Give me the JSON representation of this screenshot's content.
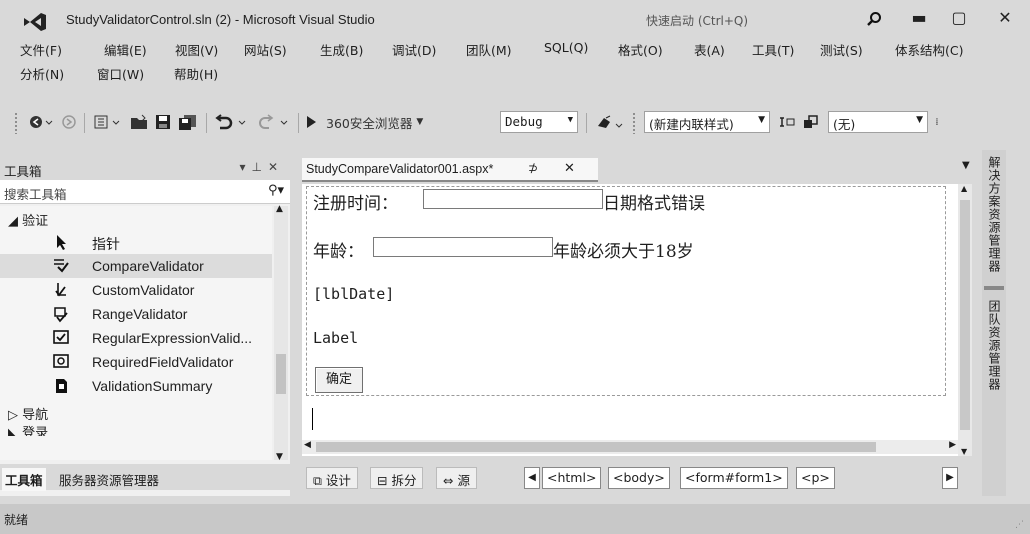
{
  "window": {
    "title": "StudyValidatorControl.sln (2) - Microsoft Visual Studio",
    "quick_launch_placeholder": "快速启动 (Ctrl+Q)",
    "minimize": "▬",
    "maximize": "▢",
    "close": "✕"
  },
  "menu": {
    "row1": [
      "文件(F)",
      "编辑(E)",
      "视图(V)",
      "网站(S)",
      "生成(B)",
      "调试(D)",
      "团队(M)",
      "SQL(Q)",
      "格式(O)",
      "表(A)",
      "工具(T)",
      "测试(S)",
      "体系结构(C)"
    ],
    "row2": [
      "分析(N)",
      "窗口(W)",
      "帮助(H)"
    ]
  },
  "toolbar": {
    "browser_label": "360安全浏览器",
    "config": "Debug",
    "style": "(新建内联样式)",
    "font": "(无)"
  },
  "toolbox": {
    "title": "工具箱",
    "search_placeholder": "搜索工具箱",
    "group_validation": "◢ 验证",
    "items": [
      "指针",
      "CompareValidator",
      "CustomValidator",
      "RangeValidator",
      "RegularExpressionValid...",
      "RequiredFieldValidator",
      "ValidationSummary"
    ],
    "group_nav": "▷ 导航",
    "group_login": "◣ 登录",
    "tabs": [
      "工具箱",
      "服务器资源管理器"
    ]
  },
  "document": {
    "tab_title": "StudyCompareValidator001.aspx*",
    "pin": "⊅",
    "close": "✕",
    "reg_time_label": "注册时间：",
    "date_error": "日期格式错误",
    "age_label": "年龄：",
    "age_error": "年龄必须大于18岁",
    "lbl_date": "[lblDate]",
    "label_text": "Label",
    "ok_button": "确定"
  },
  "view_bar": {
    "design": "设计",
    "split": "拆分",
    "source": "源",
    "tags": [
      "<html>",
      "<body>",
      "<form#form1>",
      "<p>"
    ]
  },
  "side_panels": [
    "解决方案资源管理器",
    "团队资源管理器"
  ],
  "status": "就绪"
}
